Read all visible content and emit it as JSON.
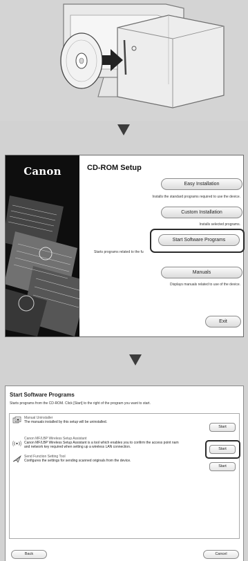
{
  "setup_window": {
    "brand": "Canon",
    "title": "CD-ROM Setup",
    "easy_install": {
      "label": "Easy Installation",
      "desc": "Installs the standard programs required to use the device."
    },
    "custom_install": {
      "label": "Custom Installation",
      "desc": "Installs selected programs."
    },
    "start_software": {
      "label": "Start Software Programs",
      "desc": "Starts programs related to the fu"
    },
    "manuals": {
      "label": "Manuals",
      "desc": "Displays manuals related to use of the device."
    },
    "exit_label": "Exit"
  },
  "ssp_window": {
    "title": "Start Software Programs",
    "subtitle": "Starts programs from the CD-ROM. Click [Start] to the right of the program you want to start.",
    "programs": [
      {
        "name": "Manual Uninstaller",
        "desc1": "The manuals installed by this setup will be uninstalled.",
        "desc2": "",
        "button": "Start",
        "icon": "uninstaller-icon"
      },
      {
        "name": "Canon MF/LBP Wireless Setup Assistant",
        "desc1": "Canon MF/LBP Wireless Setup Assistant is a tool which enables you to confirm the access point nam",
        "desc2": "and network key required when setting up a wireless LAN connection.",
        "button": "Start",
        "icon": "wireless-icon"
      },
      {
        "name": "Send Function Setting Tool",
        "desc1": "Configures the settings for sending scanned originals from the device.",
        "desc2": "",
        "button": "Start",
        "icon": "send-function-icon"
      }
    ],
    "back_label": "Back",
    "cancel_label": "Cancel"
  }
}
